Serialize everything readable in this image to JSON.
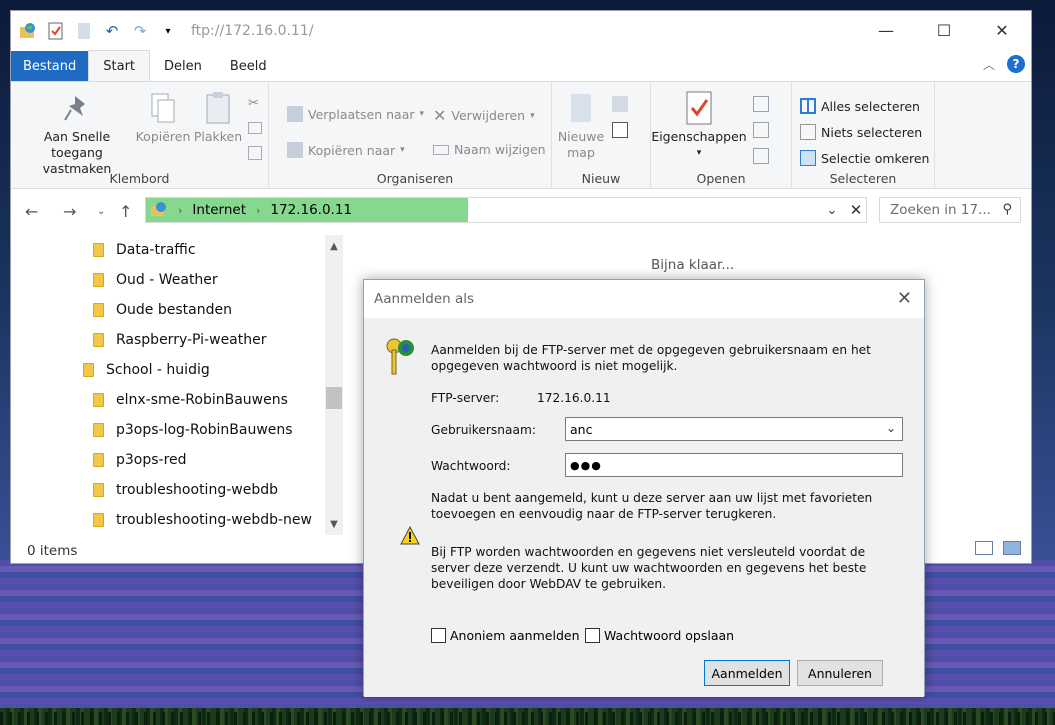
{
  "window": {
    "title": "ftp://172.16.0.11/",
    "controls": {
      "minimize": "—",
      "maximize": "☐",
      "close": "✕"
    }
  },
  "ribbon_tabs": [
    {
      "label": "Bestand"
    },
    {
      "label": "Start"
    },
    {
      "label": "Delen"
    },
    {
      "label": "Beeld"
    }
  ],
  "ribbon": {
    "klembord": {
      "label": "Klembord",
      "pin": "Aan Snelle toegang vastmaken",
      "copy": "Kopiëren",
      "paste": "Plakken"
    },
    "organiseren": {
      "label": "Organiseren",
      "move_to": "Verplaatsen naar",
      "copy_to": "Kopiëren naar",
      "delete": "Verwijderen",
      "rename": "Naam wijzigen"
    },
    "nieuw": {
      "label": "Nieuw",
      "new_folder": "Nieuwe map"
    },
    "openen": {
      "label": "Openen",
      "properties": "Eigenschappen"
    },
    "selecteren": {
      "label": "Selecteren",
      "select_all": "Alles selecteren",
      "select_none": "Niets selecteren",
      "invert": "Selectie omkeren"
    }
  },
  "address": {
    "crumbs": [
      "Internet",
      "172.16.0.11"
    ],
    "search_placeholder": "Zoeken in 17..."
  },
  "tree": [
    {
      "label": "Data-traffic",
      "level": 2
    },
    {
      "label": "Oud - Weather",
      "level": 2
    },
    {
      "label": "Oude bestanden",
      "level": 2
    },
    {
      "label": "Raspberry-Pi-weather",
      "level": 2
    },
    {
      "label": "School - huidig",
      "level": 1
    },
    {
      "label": "elnx-sme-RobinBauwens",
      "level": 2
    },
    {
      "label": "p3ops-log-RobinBauwens",
      "level": 2
    },
    {
      "label": "p3ops-red",
      "level": 2
    },
    {
      "label": "troubleshooting-webdb",
      "level": 2
    },
    {
      "label": "troubleshooting-webdb-new",
      "level": 2
    }
  ],
  "content": {
    "loading": "Bijna klaar..."
  },
  "status": {
    "items": "0 items"
  },
  "dialog": {
    "title": "Aanmelden als",
    "intro": "Aanmelden bij de FTP-server met de opgegeven gebruikersnaam en het opgegeven wachtwoord is niet mogelijk.",
    "server_label": "FTP-server:",
    "server_value": "172.16.0.11",
    "user_label": "Gebruikersnaam:",
    "user_value": "anc",
    "password_label": "Wachtwoord:",
    "password_value": "●●●",
    "favorites_note": "Nadat u bent aangemeld, kunt u deze server aan uw lijst met favorieten toevoegen en eenvoudig naar de FTP-server terugkeren.",
    "warning": "Bij FTP worden wachtwoorden en gegevens niet versleuteld voordat de server deze verzendt. U kunt uw wachtwoorden en gegevens het beste beveiligen door WebDAV te gebruiken.",
    "anon_label": "Anoniem aanmelden",
    "save_pw_label": "Wachtwoord opslaan",
    "login_button": "Aanmelden",
    "cancel_button": "Annuleren"
  }
}
